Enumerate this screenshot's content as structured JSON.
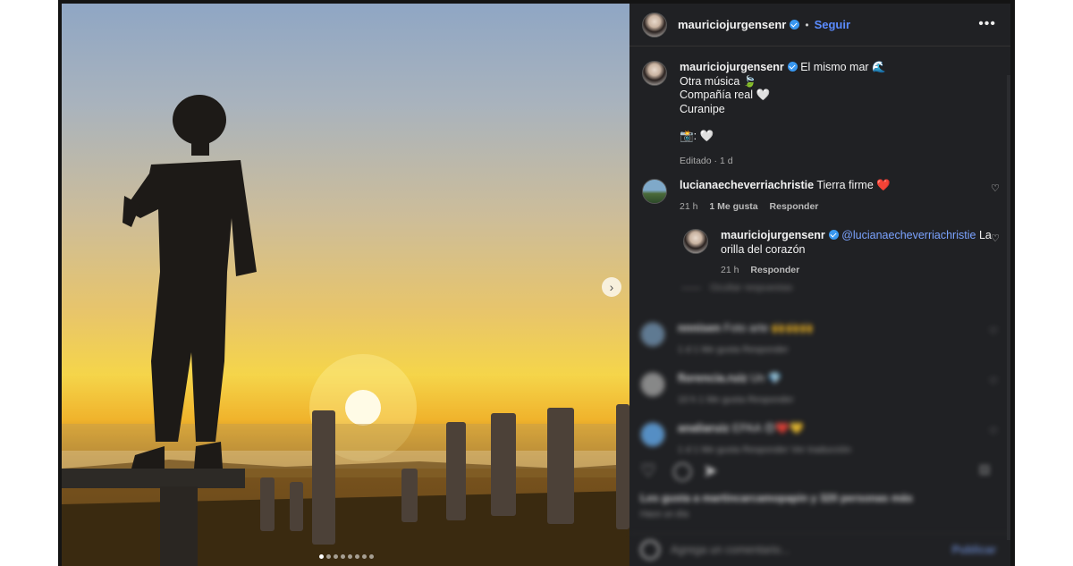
{
  "post": {
    "username": "mauriciojurgensenr",
    "follow_label": "Seguir",
    "dot_separator": "•",
    "more_icon": "•••",
    "next_icon": "›",
    "carousel_count": 8,
    "carousel_active": 1
  },
  "caption": {
    "username": "mauriciojurgensenr",
    "lines": [
      "El mismo mar 🌊",
      "Otra música 🍃",
      "Compañía real 🤍",
      "Curanipe",
      "",
      "📸: 🤍"
    ],
    "meta": "Editado · 1 d"
  },
  "comments": [
    {
      "username": "lucianaecheverriachristie",
      "text": "Tierra firme ❤️",
      "time": "21 h",
      "likes": "1 Me gusta",
      "reply": "Responder"
    },
    {
      "username": "mauriciojurgensenr",
      "mention": "@lucianaecheverriachristie",
      "text": "La orilla del corazón",
      "time": "21 h",
      "reply": "Responder"
    }
  ],
  "blurred": {
    "hide_replies": "Ocultar respuestas",
    "c1_user": "nnnisen",
    "c1_text": "Foto arte 🙌🙌🙌",
    "c1_meta": "1 d   1 Me gusta   Responder",
    "c2_user": "florencia.ruiz",
    "c2_text": "Un 💎",
    "c2_meta": "10 h   1 Me gusta   Responder",
    "c3_user": "analiaruiz",
    "c3_text": "EPAA 😍❤️💛",
    "c3_meta": "1 d   1 Me gusta   Responder   Ver traducción",
    "likes": "Les gusta a martincarcamopapin y 320 personas más",
    "time": "Hace un día",
    "placeholder": "Agrega un comentario...",
    "publish": "Publicar"
  },
  "icons": {
    "heart": "♡",
    "comment": "◯",
    "share": "➤",
    "save": "⌑",
    "verified_color": "#3897f0"
  }
}
